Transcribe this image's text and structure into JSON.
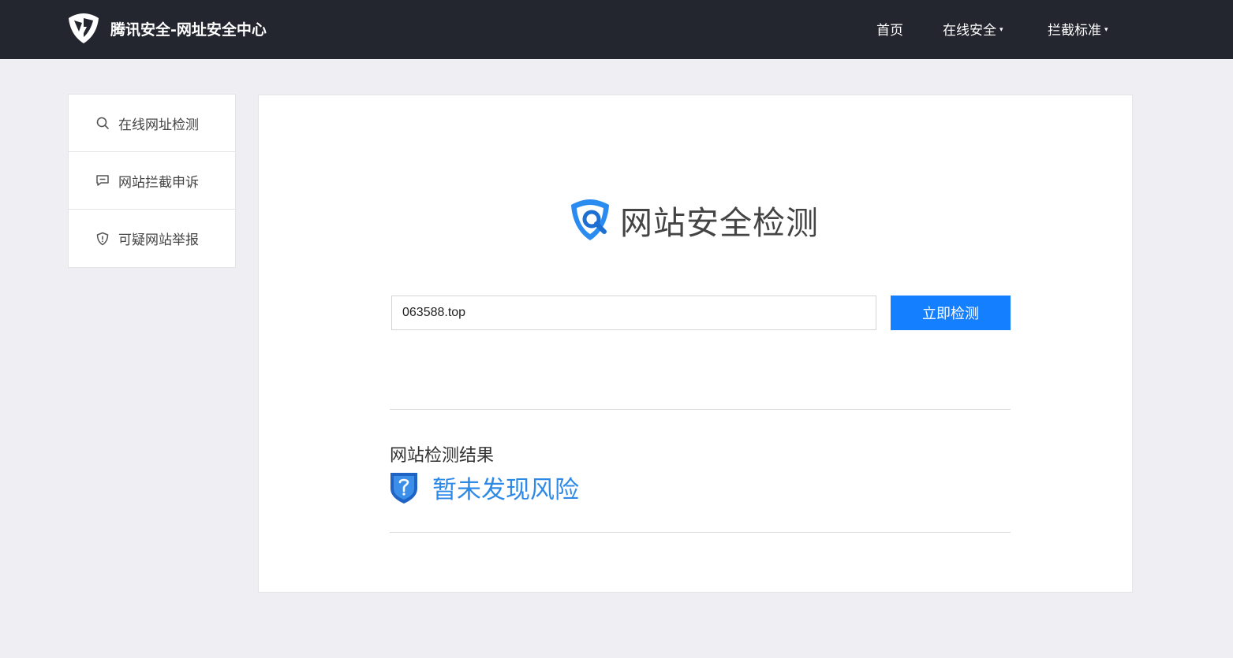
{
  "header": {
    "logo_icon": "tencent-shield-logo-icon",
    "title": "腾讯安全-网址安全中心",
    "nav": [
      {
        "label": "首页",
        "dropdown": false
      },
      {
        "label": "在线安全",
        "dropdown": true
      },
      {
        "label": "拦截标准",
        "dropdown": true
      }
    ],
    "caret": "▾"
  },
  "sidebar": {
    "items": [
      {
        "label": "在线网址检测",
        "icon": "search-icon"
      },
      {
        "label": "网站拦截申诉",
        "icon": "message-icon"
      },
      {
        "label": "可疑网站举报",
        "icon": "shield-alert-icon"
      }
    ]
  },
  "main": {
    "hero_icon": "shield-search-icon",
    "hero_title": "网站安全检测",
    "url_value": "063588.top",
    "check_button": "立即检测",
    "result_title": "网站检测结果",
    "result_icon": "shield-question-icon",
    "result_text": "暂未发现风险"
  },
  "colors": {
    "header_bg": "#23252f",
    "page_bg": "#efeff3",
    "primary": "#1580ff",
    "result_text": "#2e8ae6"
  }
}
